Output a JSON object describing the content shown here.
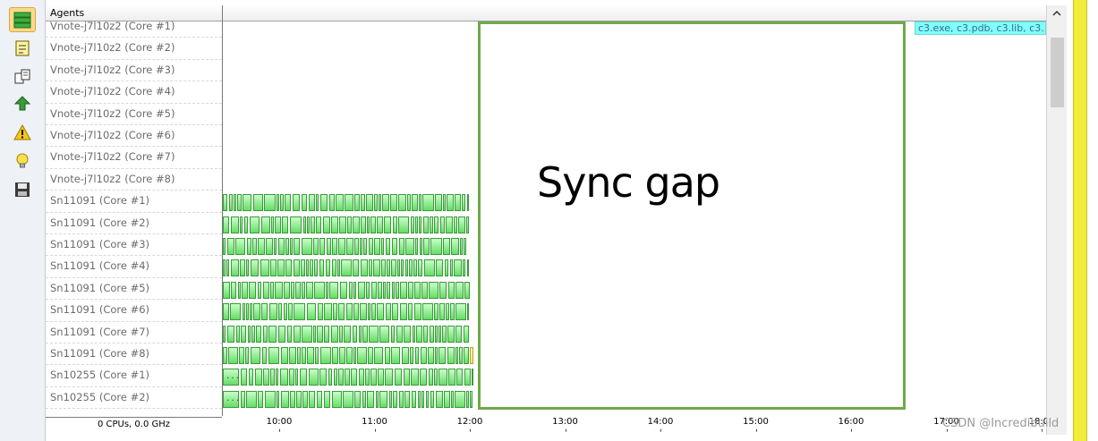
{
  "toolbar": {
    "buttons": [
      {
        "name": "agents-view-icon",
        "active": true
      },
      {
        "name": "report-icon",
        "active": false
      },
      {
        "name": "copy-icon",
        "active": false
      },
      {
        "name": "upload-icon",
        "active": false
      },
      {
        "name": "warning-icon",
        "active": false
      },
      {
        "name": "lightbulb-icon",
        "active": false
      },
      {
        "name": "save-icon",
        "active": false
      }
    ]
  },
  "agents": {
    "header": "Agents",
    "rows": [
      "Vnote-j7l10z2 (Core #1)",
      "Vnote-j7l10z2 (Core #2)",
      "Vnote-j7l10z2 (Core #3)",
      "Vnote-j7l10z2 (Core #4)",
      "Vnote-j7l10z2 (Core #5)",
      "Vnote-j7l10z2 (Core #6)",
      "Vnote-j7l10z2 (Core #7)",
      "Vnote-j7l10z2 (Core #8)",
      "Sn11091 (Core #1)",
      "Sn11091 (Core #2)",
      "Sn11091 (Core #3)",
      "Sn11091 (Core #4)",
      "Sn11091 (Core #5)",
      "Sn11091 (Core #6)",
      "Sn11091 (Core #7)",
      "Sn11091 (Core #8)",
      "Sn10255 (Core #1)",
      "Sn10255 (Core #2)"
    ],
    "status": "0 CPUs, 0.0 GHz"
  },
  "timeline": {
    "chip_text": "c3.exe, c3.pdb, c3.lib, c3.",
    "annotation": "Sync gap",
    "task_ellipsis": "...",
    "time_labels": [
      "10:00",
      "11:00",
      "12:00",
      "13:00",
      "14:00",
      "15:00",
      "16:00",
      "17:00",
      "18:00"
    ]
  },
  "colors": {
    "task_green": "#66dd66",
    "task_border": "#3b9a3b",
    "gap_border": "#6fa94a",
    "chip": "#80ffff",
    "active_tool": "#fbd98c",
    "side_bar": "#f2ec3a"
  },
  "watermark": "CSDN @Incredibuild"
}
